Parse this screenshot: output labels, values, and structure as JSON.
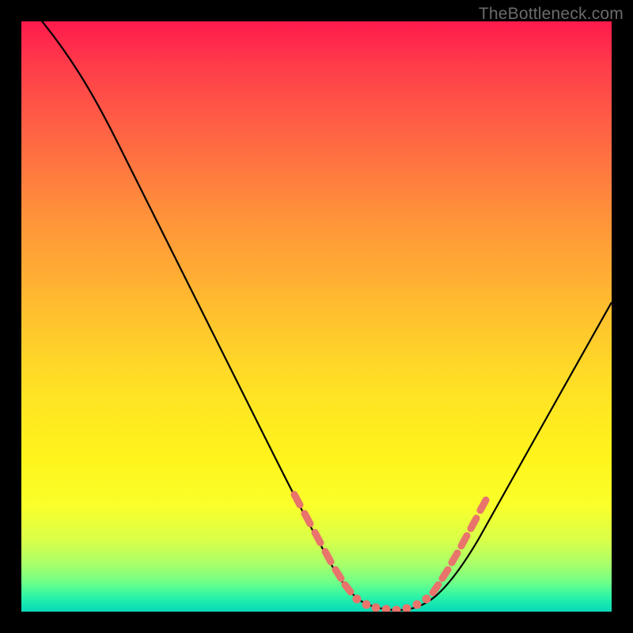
{
  "watermark": "TheBottleneck.com",
  "chart_data": {
    "type": "line",
    "title": "",
    "xlabel": "",
    "ylabel": "",
    "xlim": [
      0,
      100
    ],
    "ylim": [
      0,
      100
    ],
    "grid": false,
    "legend": false,
    "series": [
      {
        "name": "bottleneck-curve",
        "x": [
          0,
          4,
          8,
          12,
          16,
          20,
          24,
          28,
          32,
          36,
          40,
          44,
          48,
          52,
          54,
          56,
          58,
          60,
          62,
          64,
          66,
          68,
          72,
          76,
          80,
          84,
          88,
          92,
          96,
          100
        ],
        "values": [
          100,
          98,
          94,
          89,
          83,
          77,
          70,
          63,
          56,
          48,
          40,
          32,
          22,
          12,
          8,
          5,
          3,
          2,
          1,
          1,
          2,
          4,
          8,
          14,
          21,
          28,
          35,
          42,
          49,
          56
        ]
      }
    ],
    "highlight_segments": [
      {
        "name": "left-dense",
        "x_range": [
          47,
          56
        ],
        "style": "dots"
      },
      {
        "name": "bottom-flat",
        "x_range": [
          56,
          66
        ],
        "style": "dots"
      },
      {
        "name": "right-dense",
        "x_range": [
          66,
          74
        ],
        "style": "dots"
      }
    ],
    "background_gradient": {
      "top": "#ff1a4d",
      "mid": "#ffe822",
      "bottom": "#18e8b0"
    }
  }
}
